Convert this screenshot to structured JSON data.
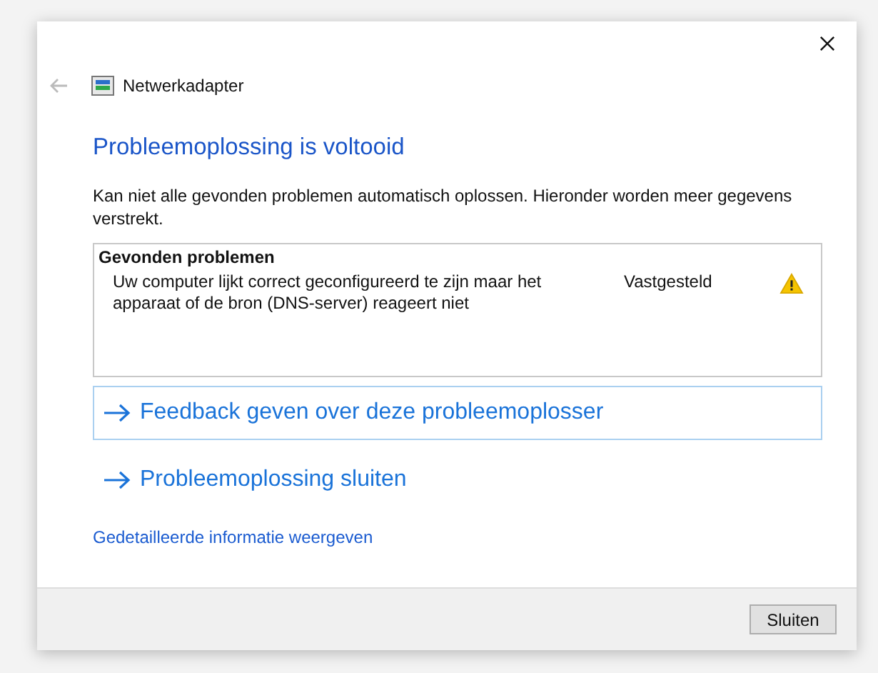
{
  "window": {
    "title": "Netwerkadapter",
    "back_disabled": true
  },
  "heading": "Probleemoplossing is voltooid",
  "message": "Kan niet alle gevonden problemen automatisch oplossen. Hieronder worden meer gegevens verstrekt.",
  "problems": {
    "title": "Gevonden problemen",
    "rows": [
      {
        "description": "Uw computer lijkt correct geconfigureerd te zijn maar het apparaat of de bron (DNS-server) reageert niet",
        "status": "Vastgesteld",
        "kind": "warning"
      }
    ]
  },
  "actions": [
    {
      "label": "Feedback geven over deze probleemoplosser",
      "selected": true
    },
    {
      "label": "Probleemoplossing sluiten",
      "selected": false
    }
  ],
  "details_link": "Gedetailleerde informatie weergeven",
  "buttons": [
    "Sluiten"
  ]
}
